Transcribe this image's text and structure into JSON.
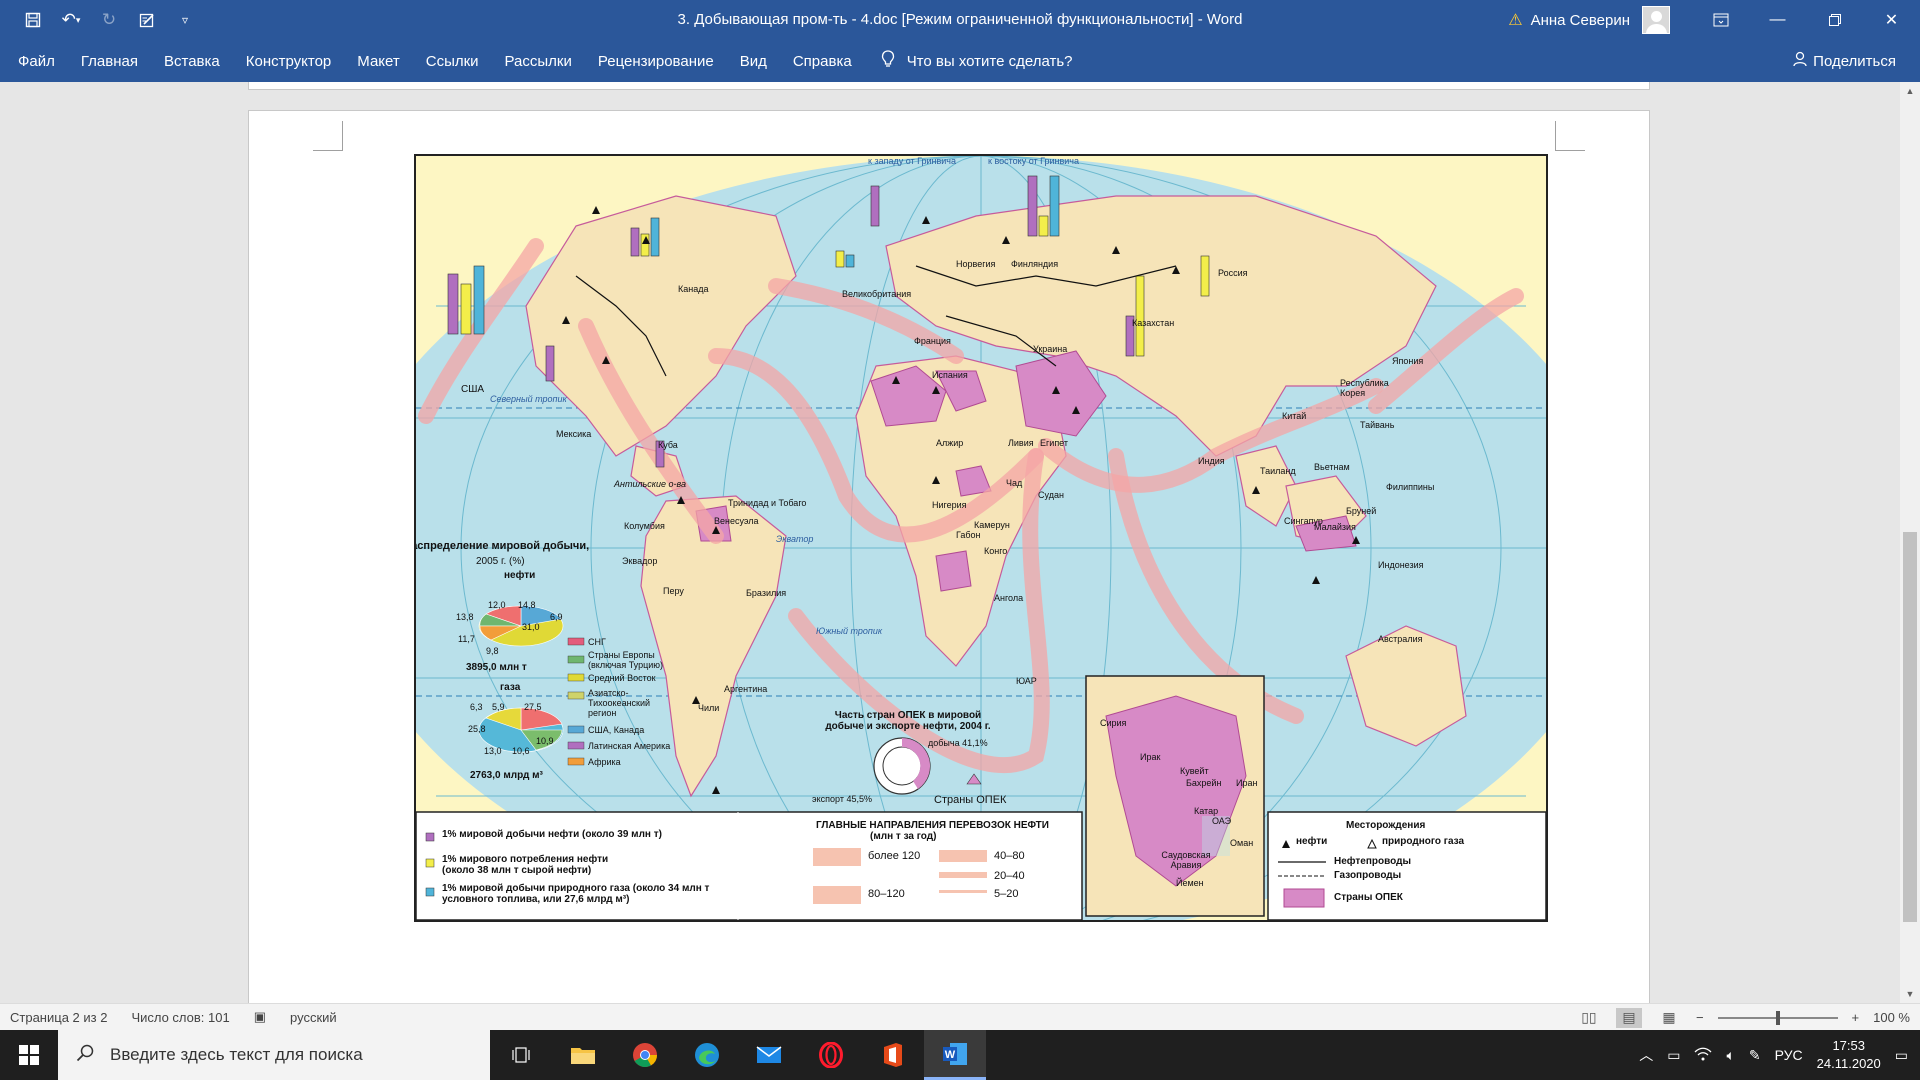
{
  "titlebar": {
    "document_title": "3. Добывающая пром-ть - 4.doc [Режим ограниченной функциональности]  -  Word",
    "user_name": "Анна Северин"
  },
  "ribbon": {
    "tabs": [
      "Файл",
      "Главная",
      "Вставка",
      "Конструктор",
      "Макет",
      "Ссылки",
      "Рассылки",
      "Рецензирование",
      "Вид",
      "Справка"
    ],
    "tell_me": "Что вы хотите сделать?",
    "share": "Поделиться"
  },
  "map": {
    "top_labels": [
      "к западу от Гринвича",
      "к востоку от Гринвича"
    ],
    "countries": {
      "usa": "США",
      "canada": "Канада",
      "mexico": "Мексика",
      "cuba": "Куба",
      "antilles": "Антильские о-ва",
      "colombia": "Колумбия",
      "venezuela": "Венесуэла",
      "trinidad": "Тринидад и Тобаго",
      "ecuador": "Эквадор",
      "peru": "Перу",
      "brazil": "Бразилия",
      "argentina": "Аргентина",
      "chile": "Чили",
      "norway": "Норвегия",
      "finland": "Финляндия",
      "uk": "Великобритания",
      "france": "Франция",
      "spain": "Испания",
      "ukraine": "Украина",
      "russia": "Россия",
      "kazakhstan": "Казахстан",
      "algeria": "Алжир",
      "libya": "Ливия",
      "egypt": "Египет",
      "chad": "Чад",
      "sudan": "Судан",
      "nigeria": "Нигерия",
      "cameroon": "Камерун",
      "gabon": "Габон",
      "congo": "Конго",
      "angola": "Ангола",
      "sar": "ЮАР",
      "india": "Индия",
      "china": "Китай",
      "japan": "Япония",
      "korea": "Республика Корея",
      "taiwan": "Тайвань",
      "thailand": "Таиланд",
      "vietnam": "Вьетнам",
      "philippines": "Филиппины",
      "brunei": "Бруней",
      "malaysia": "Малайзия",
      "singapore": "Сингапур",
      "indonesia": "Индонезия",
      "australia": "Австралия"
    },
    "lines": {
      "tropic_north": "Северный тропик",
      "tropic_south": "Южный тропик",
      "equator": "Экватор"
    },
    "distribution": {
      "title": "Распределение мировой добычи,",
      "year": "2005 г. (%)",
      "oil_heading": "нефти",
      "oil_values": [
        "12,0",
        "14,8",
        "13,8",
        "6,9",
        "31,0",
        "11,7",
        "9,8"
      ],
      "oil_total": "3895,0 млн т",
      "gas_heading": "газа",
      "gas_values": [
        "6,3",
        "5,9",
        "27,5",
        "25,8",
        "13,0",
        "10,6",
        "10,9"
      ],
      "gas_total": "2763,0 млрд м³"
    },
    "region_legend": [
      "СНГ",
      "Страны Европы (включая Турцию)",
      "Средний Восток",
      "Азиатско-Тихоокеанский регион",
      "США, Канада",
      "Латинская Америка",
      "Африка"
    ],
    "opec_share": {
      "title": "Часть стран ОПЕК в мировой добыче и экспорте нефти, 2004 г.",
      "production": "добыча 41,1%",
      "export": "экспорт 45,5%",
      "opec_label": "Страны ОПЕК"
    },
    "legend_left": [
      "1% мировой добычи нефти (около 39 млн т)",
      "1% мирового потребления нефти (около 38 млн т сырой нефти)",
      "1% мировой добычи природного газа (около 34 млн т условного топлива, или 27,6 млрд м³)"
    ],
    "flows": {
      "title": "ГЛАВНЫЕ НАПРАВЛЕНИЯ ПЕРЕВОЗОК НЕФТИ",
      "unit": "(млн т за год)",
      "items": [
        "более 120",
        "80–120",
        "40–80",
        "20–40",
        "5–20"
      ]
    },
    "inset": {
      "countries": [
        "Сирия",
        "Ирак",
        "Иран",
        "Кувейт",
        "Бахрейн",
        "Катар",
        "ОАЭ",
        "Оман",
        "Саудовская Аравия",
        "Йемен"
      ]
    },
    "legend_right": {
      "title": "Месторождения",
      "oil": "нефти",
      "gas": "природного газа",
      "oil_pipe": "Нефтепроводы",
      "gas_pipe": "Газопроводы",
      "opec": "Страны ОПЕК"
    }
  },
  "statusbar": {
    "page": "Страница 2 из 2",
    "words": "Число слов: 101",
    "language": "русский",
    "zoom": "100 %"
  },
  "taskbar": {
    "search_placeholder": "Введите здесь текст для поиска",
    "lang": "РУС",
    "time": "17:53",
    "date": "24.11.2020"
  }
}
